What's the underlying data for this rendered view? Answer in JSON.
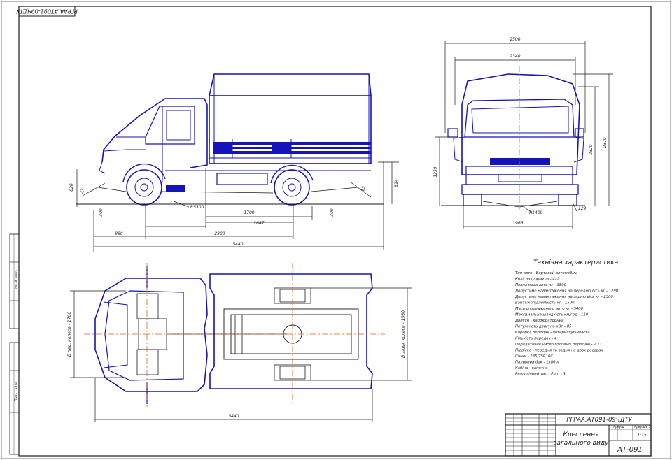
{
  "frame": {
    "stamp_top": "РГРАА.АТ091-09ЧДТУ"
  },
  "side_view": {
    "dims": {
      "overall_length": "5440",
      "front_overhang": "990",
      "wheelbase": "2900",
      "track_2647": "2647",
      "platform_1700": "1700",
      "ground_clearance_front": "300",
      "ground_clearance_rear": "300",
      "turn_radius": "R5300",
      "height_left": "820",
      "angle_left": "27",
      "height_right": "814",
      "angle_right": "15"
    }
  },
  "front_view": {
    "dims": {
      "overall_width": "2500",
      "body_width": "2340",
      "track": "1966",
      "height_total": "2370",
      "height_body": "2320",
      "height_side": "1239",
      "clearance": "R1400",
      "small_dim": "129"
    }
  },
  "top_view": {
    "dims": {
      "overall_length": "5440",
      "front_track": "1700",
      "rear_track": "1560"
    },
    "labels": {
      "front": "В пер. колесе - 1700",
      "rear": "В задн. колесе - 1560"
    }
  },
  "specs": {
    "title": "Технічна характеристика",
    "lines": [
      "Тип авто - Бортовий автомобіль",
      "Колісна формула - 4х2",
      "Повна маса авто кг - 3590",
      "Допустиме навантаження на передню вісь кг - 1290",
      "Допустиме навантаження на задню вісь кг - 2300",
      "Вантажопідйомність кг - 1500",
      "Маса спорядженого авто кг - 5400",
      "Максимальна швидкість км/год - 110",
      "Двигун - карбюраторний",
      "Потужність двигуна кВт - 85",
      "Коробка передач - чотириступінчаста",
      "Кількість передач - 4",
      "Передаточне число головної передачі - 2,17",
      "Підвіска - передня та задня на двох ресорах",
      "Шини - 185/75R16C",
      "Паливний бак - 1х80 л",
      "Кабіна - капотна",
      "Екологічний тип - Euro - 3"
    ]
  },
  "title_block": {
    "doc_code": "РГРАА.АТ091-09ЧДТУ",
    "title_line1": "Креслення",
    "title_line2": "загального виду",
    "mass": "1:15",
    "group": "АТ-091",
    "sheet_label": "Аркуш",
    "sheets_label": "Аркушів 1"
  },
  "left_strip": {
    "label1": "Інв. № ориг.",
    "label2": "Підп. і дата"
  }
}
